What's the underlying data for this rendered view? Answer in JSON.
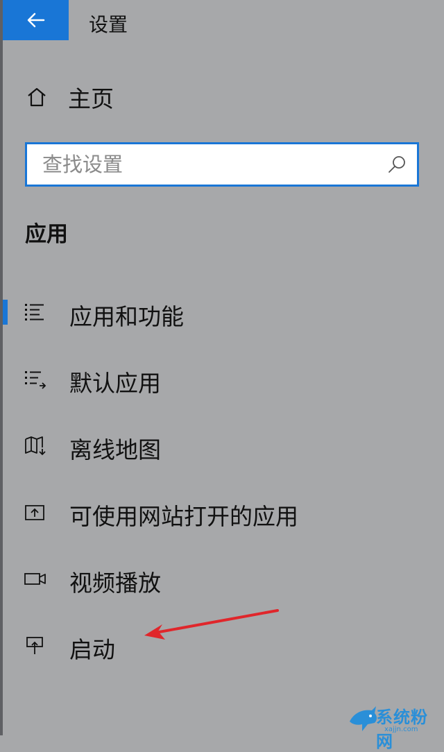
{
  "header": {
    "title": "设置",
    "back_icon": "arrow-left-icon"
  },
  "home": {
    "label": "主页",
    "icon": "home-icon"
  },
  "search": {
    "placeholder": "查找设置",
    "icon": "search-icon"
  },
  "section": {
    "title": "应用"
  },
  "nav": {
    "items": [
      {
        "label": "应用和功能",
        "icon": "apps-features-icon",
        "active": true
      },
      {
        "label": "默认应用",
        "icon": "default-apps-icon",
        "active": false
      },
      {
        "label": "离线地图",
        "icon": "offline-maps-icon",
        "active": false
      },
      {
        "label": "可使用网站打开的应用",
        "icon": "apps-for-websites-icon",
        "active": false
      },
      {
        "label": "视频播放",
        "icon": "video-playback-icon",
        "active": false
      },
      {
        "label": "启动",
        "icon": "startup-icon",
        "active": false
      }
    ]
  },
  "colors": {
    "accent": "#1976d6",
    "background": "#a7a8aa",
    "annotation_arrow": "#e0262b"
  },
  "watermark": {
    "logo_text": "系统粉网",
    "url_text": "xajjn.com"
  }
}
